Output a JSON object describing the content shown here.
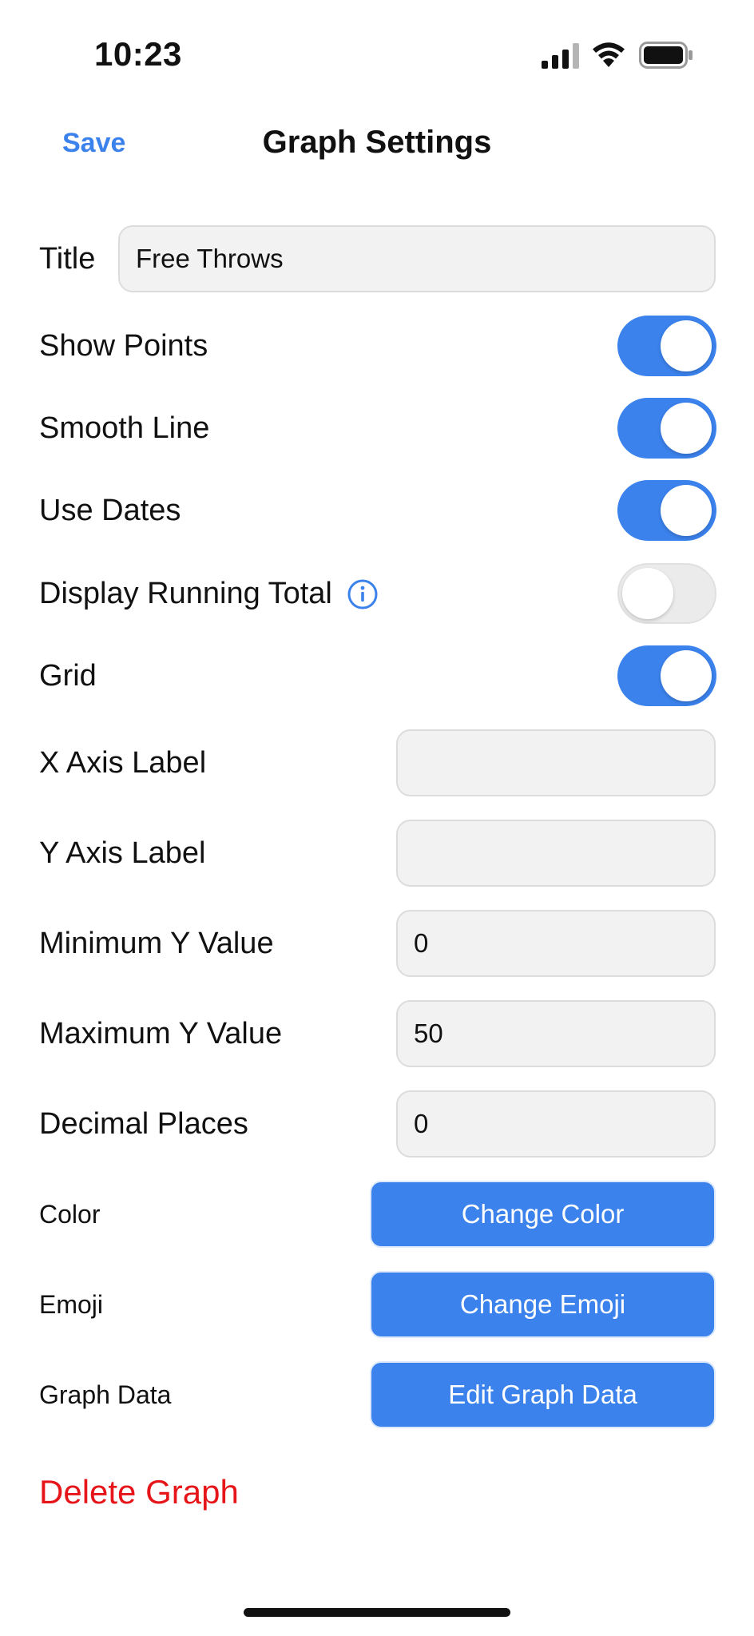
{
  "status_bar": {
    "time": "10:23",
    "icons": [
      "signal-icon",
      "wifi-icon",
      "battery-icon"
    ]
  },
  "nav": {
    "save_label": "Save",
    "title": "Graph Settings"
  },
  "form": {
    "title_label": "Title",
    "title_value": "Free Throws",
    "toggles": {
      "show_points": {
        "label": "Show Points",
        "on": true
      },
      "smooth_line": {
        "label": "Smooth Line",
        "on": true
      },
      "use_dates": {
        "label": "Use Dates",
        "on": true
      },
      "display_running_total": {
        "label": "Display Running Total",
        "on": false,
        "icon": "info-icon"
      },
      "grid": {
        "label": "Grid",
        "on": true
      }
    },
    "x_axis_label": {
      "label": "X Axis Label",
      "value": ""
    },
    "y_axis_label": {
      "label": "Y Axis Label",
      "value": ""
    },
    "min_y": {
      "label": "Minimum Y Value",
      "value": "0"
    },
    "max_y": {
      "label": "Maximum Y Value",
      "value": "50"
    },
    "decimal_places": {
      "label": "Decimal Places",
      "value": "0"
    },
    "color": {
      "label": "Color",
      "button": "Change Color"
    },
    "emoji": {
      "label": "Emoji",
      "button": "Change Emoji"
    },
    "graph_data": {
      "label": "Graph Data",
      "button": "Edit Graph Data"
    }
  },
  "delete_label": "Delete Graph",
  "colors": {
    "accent": "#3B82EC",
    "destructive": "#E5151A",
    "field_bg": "#F2F2F2"
  }
}
